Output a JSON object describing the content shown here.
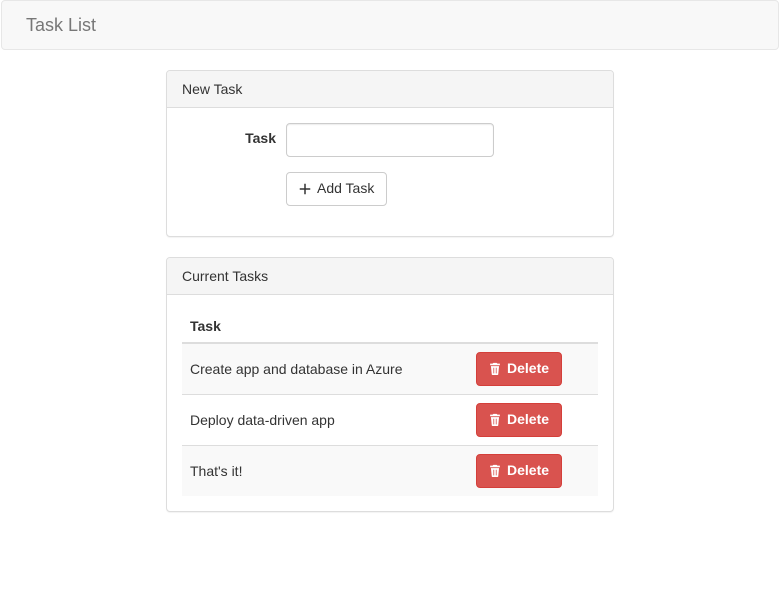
{
  "navbar": {
    "brand": "Task List"
  },
  "newTaskPanel": {
    "heading": "New Task",
    "label": "Task",
    "inputValue": "",
    "addButton": "Add Task"
  },
  "currentTasksPanel": {
    "heading": "Current Tasks",
    "columnHeader": "Task",
    "deleteLabel": "Delete",
    "tasks": [
      {
        "name": "Create app and database in Azure"
      },
      {
        "name": "Deploy data-driven app"
      },
      {
        "name": "That's it!"
      }
    ]
  }
}
